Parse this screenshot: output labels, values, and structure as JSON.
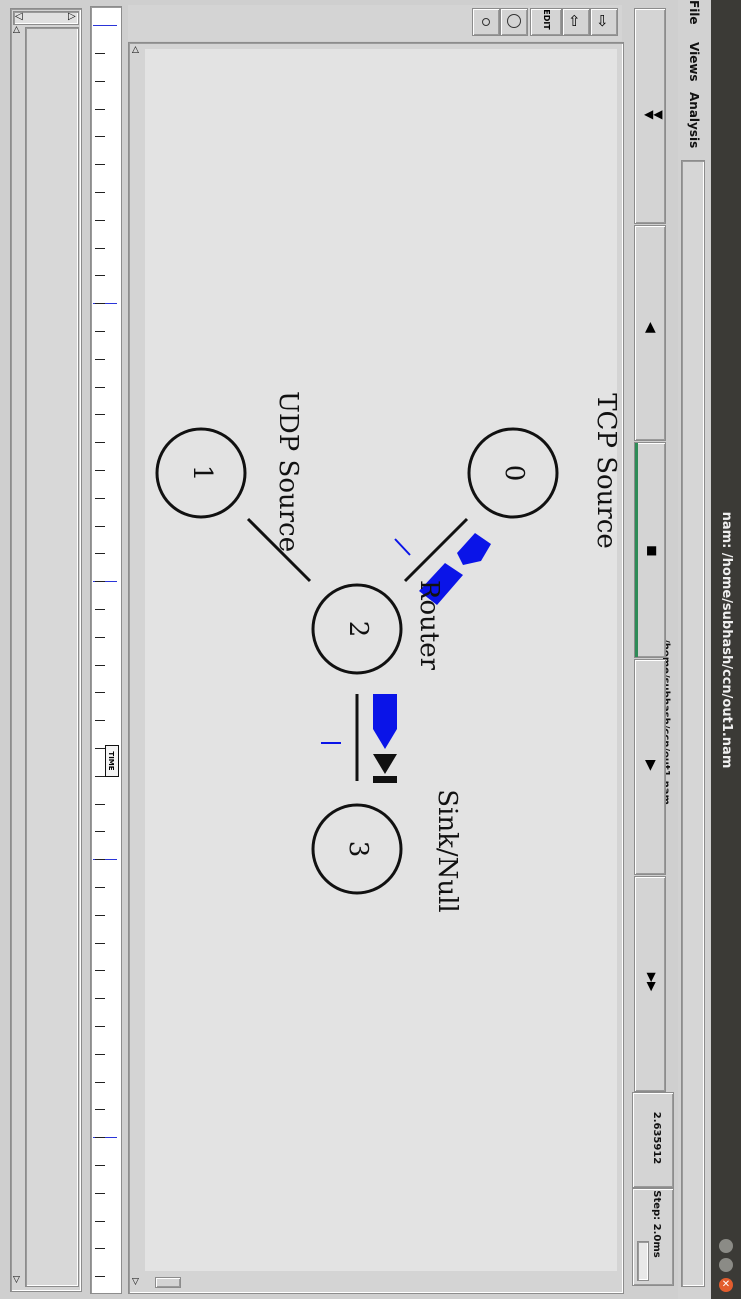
{
  "window": {
    "title": "nam: /home/subhash/ccn/out1.nam",
    "colors": {
      "titlebar": "#3b3a36",
      "close": "#e35d2e",
      "canvas": "#e3e3e3",
      "packet": "#0a14e8",
      "queue_bar": "#2e8b57"
    }
  },
  "menu": {
    "file": "File",
    "views": "Views",
    "analysis": "Analysis"
  },
  "header": {
    "file_path": "/home/subhash/ccn/out1.nam"
  },
  "playback": {
    "buttons": [
      {
        "name": "rewind-button",
        "icon": "rewind-icon",
        "glyph": "◀◀"
      },
      {
        "name": "play-back-button",
        "icon": "play-back-icon",
        "glyph": "◀"
      },
      {
        "name": "stop-button",
        "icon": "stop-icon",
        "glyph": "■"
      },
      {
        "name": "play-forward-button",
        "icon": "play-forward-icon",
        "glyph": "▶"
      },
      {
        "name": "fast-forward-button",
        "icon": "fast-forward-icon",
        "glyph": "▶▶"
      }
    ],
    "time": "2.635912",
    "step": "Step: 2.0ms"
  },
  "toolbar": {
    "edit_label": "EDIT",
    "tools": [
      "zoom-in-icon",
      "zoom-out-icon",
      "edit-icon",
      "small-circle-icon",
      "large-circle-icon"
    ]
  },
  "topology": {
    "nodes": [
      {
        "id": "0",
        "label": "TCP Source"
      },
      {
        "id": "1",
        "label": "UDP Source"
      },
      {
        "id": "2",
        "label": "Router"
      },
      {
        "id": "3",
        "label": "Sink/Null"
      }
    ]
  },
  "timeline": {
    "marker_label": "TIME"
  }
}
